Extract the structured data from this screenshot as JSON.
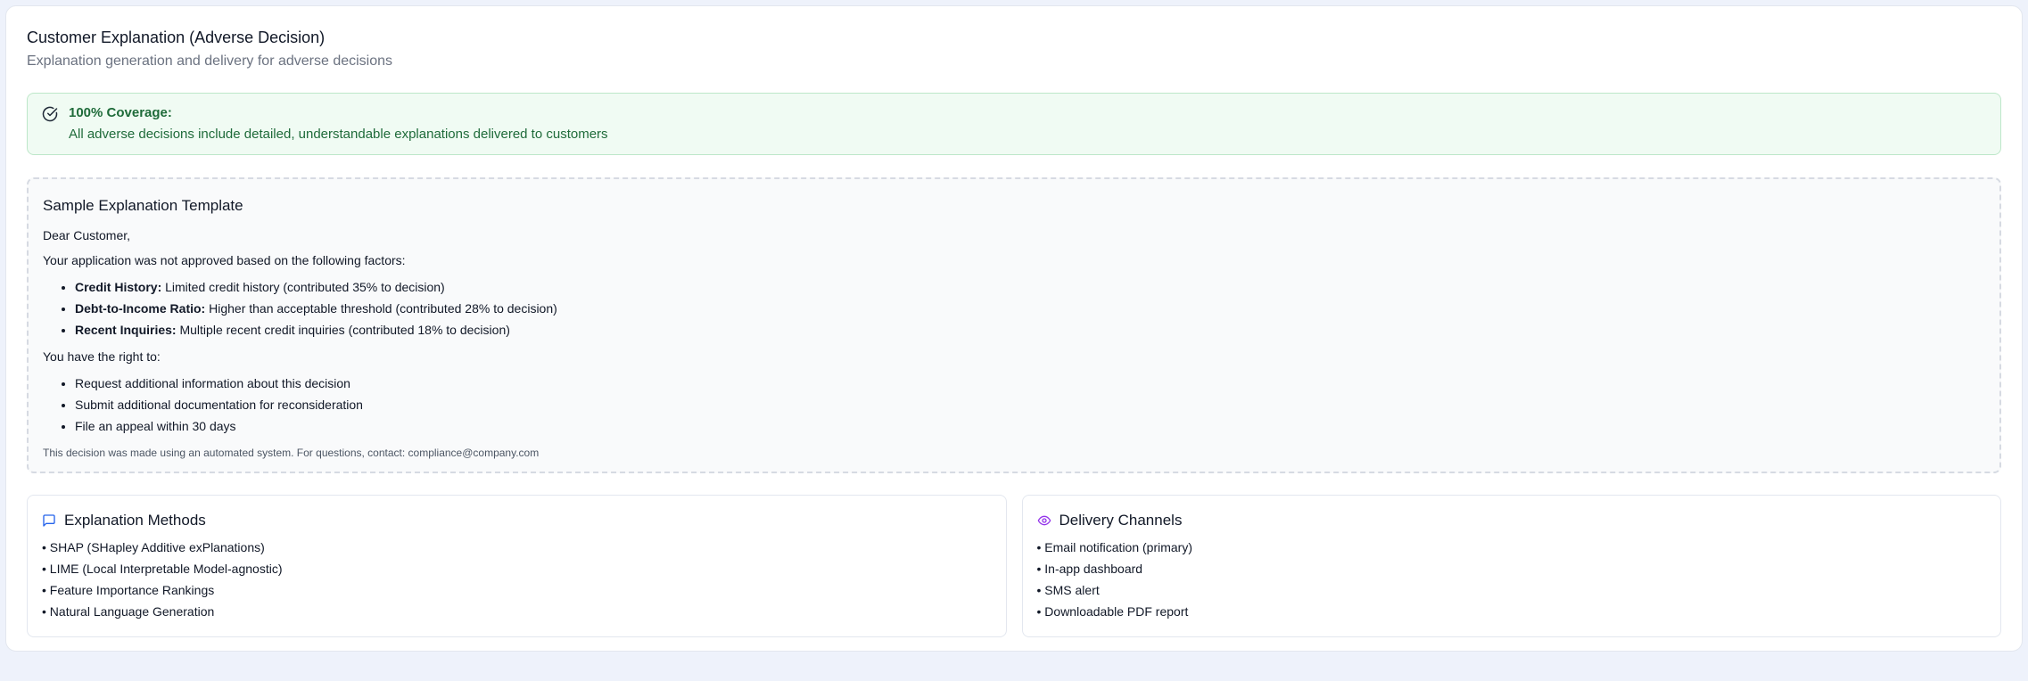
{
  "header": {
    "title": "Customer Explanation (Adverse Decision)",
    "subtitle": "Explanation generation and delivery for adverse decisions"
  },
  "coverage_alert": {
    "icon": "check-circle-icon",
    "title": "100% Coverage:",
    "text": "All adverse decisions include detailed, understandable explanations delivered to customers"
  },
  "template": {
    "title": "Sample Explanation Template",
    "greeting": "Dear Customer,",
    "intro": "Your application was not approved based on the following factors:",
    "factors": [
      {
        "name": "Credit History:",
        "detail": " Limited credit history (contributed 35% to decision)"
      },
      {
        "name": "Debt-to-Income Ratio:",
        "detail": " Higher than acceptable threshold (contributed 28% to decision)"
      },
      {
        "name": "Recent Inquiries:",
        "detail": " Multiple recent credit inquiries (contributed 18% to decision)"
      }
    ],
    "rights_intro": "You have the right to:",
    "rights": [
      "Request additional information about this decision",
      "Submit additional documentation for reconsideration",
      "File an appeal within 30 days"
    ],
    "footnote": "This decision was made using an automated system. For questions, contact: compliance@company.com"
  },
  "explanation_methods": {
    "icon": "message-square-icon",
    "title": "Explanation Methods",
    "items": [
      "SHAP (SHapley Additive exPlanations)",
      "LIME (Local Interpretable Model-agnostic)",
      "Feature Importance Rankings",
      "Natural Language Generation"
    ]
  },
  "delivery_channels": {
    "icon": "eye-icon",
    "title": "Delivery Channels",
    "items": [
      "Email notification (primary)",
      "In-app dashboard",
      "SMS alert",
      "Downloadable PDF report"
    ]
  },
  "colors": {
    "page_bg": "#eef2fb",
    "alert_bg": "#f0fbf3",
    "alert_text": "#1f6b3a",
    "methods_icon": "#2563eb",
    "channels_icon": "#9333ea"
  }
}
